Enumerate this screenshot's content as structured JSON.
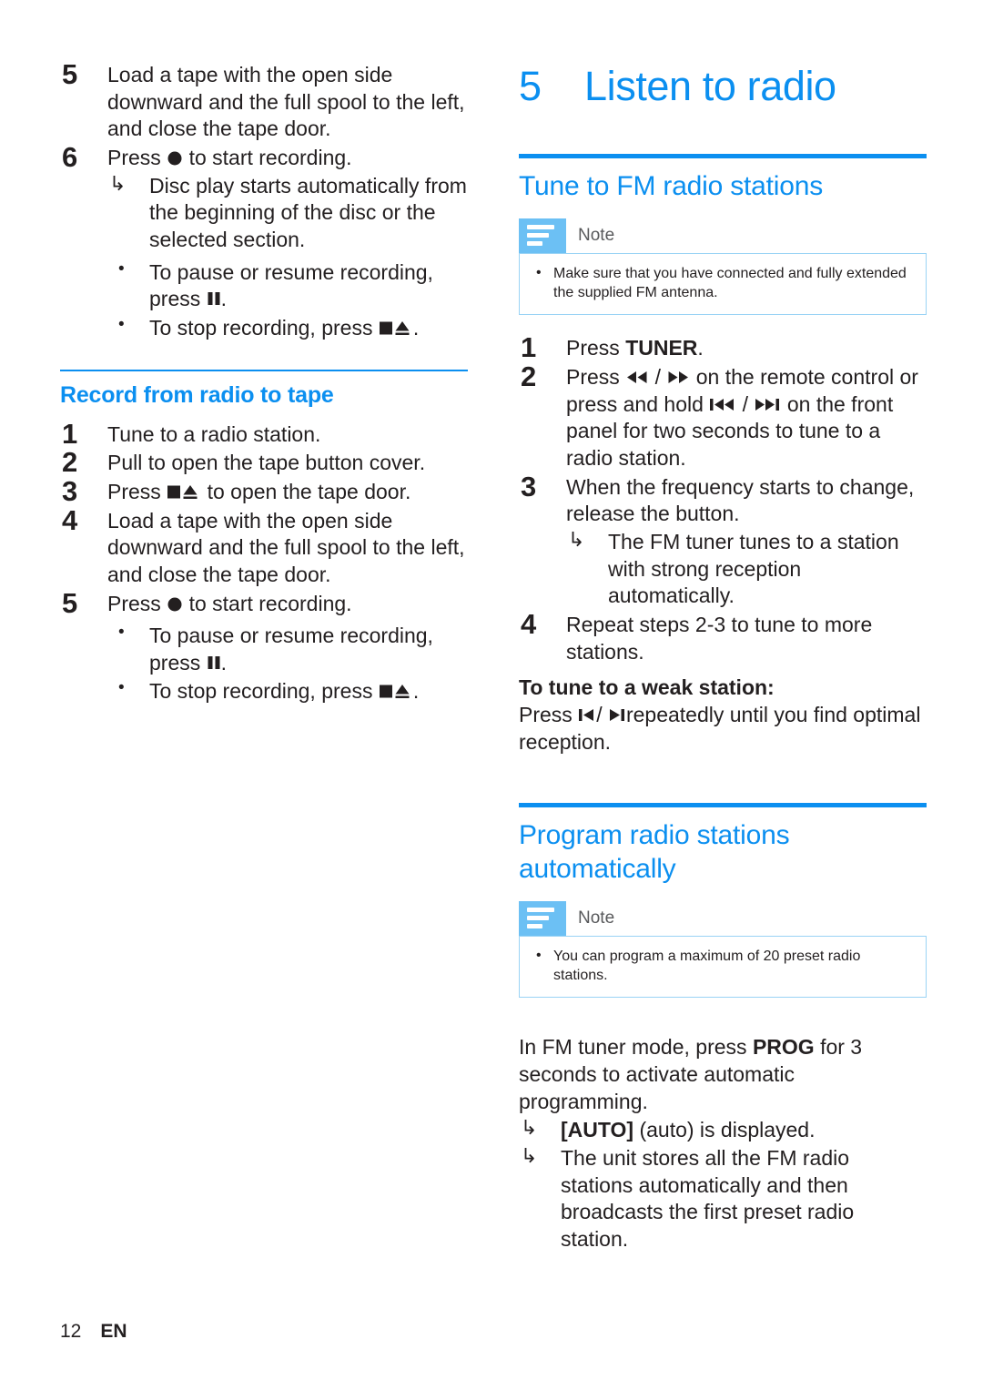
{
  "page": {
    "number": "12",
    "language": "EN"
  },
  "left_column": {
    "continued_steps": [
      {
        "num": "5",
        "text": "Load a tape with the open side downward and the full spool to the left, and close the tape door."
      },
      {
        "num": "6",
        "text_before": "Press",
        "symbol": "record-dot",
        "text_after": "to start recording."
      }
    ],
    "step6_results": [
      "Disc play starts automatically from the beginning of the disc or the selected section."
    ],
    "step6_bullets": [
      {
        "text_before": "To pause or resume recording, press",
        "symbol": "pause-bars",
        "text_after": "."
      },
      {
        "text_before": "To stop recording, press",
        "symbol": "stop-eject",
        "text_after": "."
      }
    ],
    "subsection_title": "Record from radio to tape",
    "record_steps": [
      {
        "num": "1",
        "text": "Tune to a radio station."
      },
      {
        "num": "2",
        "text": "Pull to open the tape button cover."
      },
      {
        "num": "3",
        "text_before": "Press",
        "symbol": "stop-eject",
        "text_after": "to open the tape door."
      },
      {
        "num": "4",
        "text": "Load a tape with the open side downward and the full spool to the left, and close the tape door."
      },
      {
        "num": "5",
        "text_before": "Press",
        "symbol": "record-dot",
        "text_after": "to start recording."
      }
    ],
    "record_step5_bullets": [
      {
        "text_before": "To pause or resume recording, press",
        "symbol": "pause-bars",
        "text_after": "."
      },
      {
        "text_before": "To stop recording, press",
        "symbol": "stop-eject",
        "text_after": "."
      }
    ]
  },
  "right_column": {
    "chapter_number": "5",
    "chapter_title": "Listen to radio",
    "section_tune": {
      "title": "Tune to FM radio stations",
      "note": {
        "label": "Note",
        "items": [
          "Make sure that you have connected and fully extended the supplied FM antenna."
        ]
      },
      "steps": [
        {
          "num": "1",
          "text_before": "Press",
          "strong": "TUNER",
          "text_after": "."
        },
        {
          "num": "2",
          "part1": "Press",
          "symbol1": "rewind-double",
          "sep": "/",
          "symbol2": "forward-double",
          "part2": "on the remote control or press and hold",
          "symbol3": "prev-track",
          "sep2": "/",
          "symbol4": "next-track",
          "part3": "on the front panel for two seconds to tune to a radio station."
        },
        {
          "num": "3",
          "text": "When the frequency starts to change, release the button."
        },
        {
          "num": "4",
          "text": "Repeat steps 2-3 to tune to more stations."
        }
      ],
      "step3_results": [
        "The FM tuner tunes to a station with strong reception automatically."
      ],
      "weak_station": {
        "heading": "To tune to a weak station:",
        "text_before": "Press",
        "symbol1": "skip-prev",
        "sep": "/",
        "symbol2": "skip-next",
        "text_after": "repeatedly until you find optimal reception."
      }
    },
    "section_program": {
      "title": "Program radio stations automatically",
      "note": {
        "label": "Note",
        "items": [
          "You can program a maximum of 20 preset radio stations."
        ]
      },
      "instruction_before": "In FM tuner mode, press",
      "instruction_strong": "PROG",
      "instruction_after": "for 3 seconds to activate automatic programming.",
      "results": [
        {
          "strong": "[AUTO]",
          "text": "(auto) is displayed."
        },
        {
          "text": "The unit stores all the FM radio stations automatically and then broadcasts the first preset radio station."
        }
      ]
    }
  },
  "colors": {
    "accent_blue": "#0b8ff0",
    "note_icon_blue": "#6cc0f4",
    "note_border_blue": "#9ad3f5",
    "text_black": "#231f20",
    "note_label_gray": "#58595b"
  }
}
